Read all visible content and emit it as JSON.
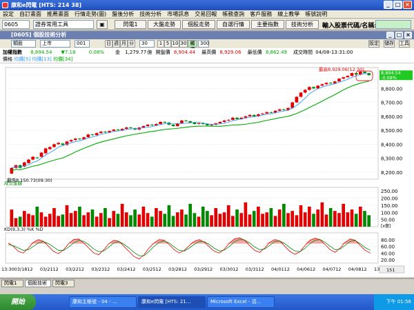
{
  "window": {
    "title": "康和e閃電 [HTS: 214 38]",
    "subwindow_title": "[0605] 個股技術分析"
  },
  "menu": [
    "設定",
    "自訂畫面",
    "推薦畫面",
    "行情走勢(圖)",
    "盤後分析",
    "技術分析",
    "市場訊息",
    "交易回報",
    "帳務查詢",
    "客戶服務",
    "線上教學",
    "帳號說明"
  ],
  "toolbar": {
    "stock_code": "0605",
    "tool_select": "證券常用工具",
    "buttons": [
      "閃電1",
      "大盤走勢",
      "個股走勢",
      "自選行情",
      "主要指數",
      "技術分析"
    ],
    "search_label": "輸入股票代碼/名稱:"
  },
  "chartbar": {
    "symbol": "類股",
    "market": "上市",
    "index": "001",
    "periods": [
      "日",
      "週",
      "月",
      "分"
    ],
    "interval": "30",
    "minutes": [
      "1",
      "5",
      "10",
      "30"
    ],
    "active": "觸價",
    "count": "300",
    "right_buttons": [
      "設定",
      "儲存",
      "工具"
    ]
  },
  "quote": {
    "name": "加權指數",
    "price": "8,894.54",
    "change": "▼7.18",
    "pct": "0.08%",
    "volume_label": "金",
    "volume": "1,279.77",
    "vol_unit": "億",
    "open_label": "開盤價",
    "open": "8,904.44",
    "high_label": "最高價",
    "high": "8,929.06",
    "low_label": "最低價",
    "low": "8,862.49",
    "time_label": "成交時間",
    "time": "04/08-13:31:00"
  },
  "chart_data": {
    "type": "candlestick",
    "legend": [
      "價格",
      "均價[5]",
      "均價[13]",
      "均價[34]"
    ],
    "price_axis": [
      "8,900.00",
      "8,800.00",
      "8,700.00",
      "8,600.00",
      "8,500.00",
      "8,400.00",
      "8,300.00",
      "8,200.00"
    ],
    "price_ylim": [
      8150,
      8950
    ],
    "last_price_tag": "8,894.54",
    "last_pct_tag": "-0.08%",
    "high_annotation": "最高8,929.06(12:30)",
    "low_annotation": "最低8,150.73(09:30)",
    "volume_title": "成交金額",
    "volume_axis": [
      "250.00",
      "200.00",
      "150.00",
      "100.00",
      "50.00"
    ],
    "volume_unit": "[x億]",
    "kd_title": "KD(9,3,3) %K %D",
    "kd_axis": [
      "80.00",
      "60.00",
      "40.00",
      "20.00"
    ],
    "x_labels": [
      "13:30",
      "03/18",
      "12",
      "03/21",
      "12",
      "03/22",
      "12",
      "03/23",
      "12",
      "03/24",
      "12",
      "03/25",
      "12",
      "03/28",
      "12",
      "03/29",
      "12",
      "03/30",
      "12",
      "03/31",
      "12",
      "04/01",
      "12",
      "04/06",
      "12",
      "04/07",
      "12",
      "04/08",
      "12",
      "13:30"
    ],
    "scroll_label": "151",
    "ma5_color": "#3399ff",
    "ma13_color": "#00aa00",
    "up_color": "#e00000",
    "down_color": "#008800",
    "candles": [
      [
        8190,
        8230
      ],
      [
        8230,
        8250
      ],
      [
        8250,
        8230
      ],
      [
        8240,
        8270
      ],
      [
        8265,
        8290
      ],
      [
        8290,
        8310
      ],
      [
        8305,
        8300
      ],
      [
        8310,
        8340
      ],
      [
        8335,
        8370
      ],
      [
        8365,
        8380
      ],
      [
        8380,
        8400
      ],
      [
        8400,
        8410
      ],
      [
        8405,
        8395
      ],
      [
        8395,
        8420
      ],
      [
        8420,
        8430
      ],
      [
        8430,
        8440
      ],
      [
        8440,
        8435
      ],
      [
        8435,
        8450
      ],
      [
        8450,
        8470
      ],
      [
        8470,
        8465
      ],
      [
        8465,
        8480
      ],
      [
        8480,
        8490
      ],
      [
        8490,
        8485
      ],
      [
        8485,
        8495
      ],
      [
        8495,
        8505
      ],
      [
        8505,
        8500
      ],
      [
        8500,
        8510
      ],
      [
        8510,
        8520
      ],
      [
        8520,
        8515
      ],
      [
        8515,
        8505
      ],
      [
        8505,
        8520
      ],
      [
        8520,
        8530
      ],
      [
        8530,
        8540
      ],
      [
        8540,
        8535
      ],
      [
        8535,
        8545
      ],
      [
        8545,
        8560
      ],
      [
        8560,
        8555
      ],
      [
        8555,
        8540
      ],
      [
        8540,
        8530
      ],
      [
        8530,
        8550
      ],
      [
        8550,
        8570
      ],
      [
        8570,
        8565
      ],
      [
        8565,
        8555
      ],
      [
        8555,
        8545
      ],
      [
        8545,
        8550
      ],
      [
        8550,
        8545
      ],
      [
        8545,
        8535
      ],
      [
        8535,
        8540
      ],
      [
        8540,
        8550
      ],
      [
        8550,
        8560
      ],
      [
        8560,
        8570
      ],
      [
        8570,
        8575
      ],
      [
        8575,
        8590
      ],
      [
        8590,
        8580
      ],
      [
        8580,
        8590
      ],
      [
        8590,
        8600
      ],
      [
        8600,
        8610
      ],
      [
        8610,
        8600
      ],
      [
        8600,
        8615
      ],
      [
        8615,
        8620
      ],
      [
        8620,
        8630
      ],
      [
        8630,
        8625
      ],
      [
        8625,
        8640
      ],
      [
        8640,
        8650
      ],
      [
        8650,
        8645
      ],
      [
        8645,
        8660
      ],
      [
        8660,
        8700
      ],
      [
        8700,
        8740
      ],
      [
        8740,
        8770
      ],
      [
        8770,
        8790
      ],
      [
        8790,
        8810
      ],
      [
        8810,
        8800
      ],
      [
        8800,
        8820
      ],
      [
        8820,
        8830
      ],
      [
        8830,
        8840
      ],
      [
        8840,
        8835
      ],
      [
        8835,
        8850
      ],
      [
        8850,
        8870
      ],
      [
        8870,
        8880
      ],
      [
        8880,
        8890
      ],
      [
        8890,
        8910
      ],
      [
        8910,
        8900
      ],
      [
        8900,
        8920
      ],
      [
        8920,
        8910
      ],
      [
        8910,
        8895
      ]
    ],
    "volumes": [
      120,
      60,
      70,
      110,
      90,
      80,
      140,
      100,
      70,
      90,
      130,
      75,
      85,
      150,
      95,
      110,
      140,
      80,
      100,
      120,
      70,
      95,
      130,
      60,
      110,
      90,
      160,
      100,
      80,
      120,
      85,
      140,
      95,
      70,
      130,
      110,
      90,
      150,
      75,
      100,
      120,
      85,
      160,
      95,
      70,
      140,
      110,
      80,
      130,
      90,
      100,
      150,
      75,
      120,
      95,
      170,
      85,
      110,
      140,
      90,
      100,
      130,
      75,
      120,
      160,
      95,
      110,
      80,
      150,
      100,
      140,
      90,
      120,
      170,
      85,
      130,
      110,
      95,
      160,
      100,
      120,
      90,
      140,
      110,
      80
    ],
    "kd_k": [
      70,
      60,
      45,
      40,
      55,
      72,
      80,
      75,
      60,
      45,
      38,
      50,
      68,
      80,
      82,
      70,
      55,
      40,
      35,
      50,
      68,
      78,
      75,
      60,
      45,
      30,
      22,
      35,
      55,
      70,
      80,
      78,
      65,
      50,
      40,
      48,
      62,
      75,
      80,
      72,
      58,
      45,
      40,
      52,
      70,
      82,
      85,
      78,
      62,
      48,
      42,
      55,
      72,
      80,
      76,
      60,
      45,
      36,
      44,
      62,
      78,
      84,
      80,
      65,
      50,
      42,
      55,
      72,
      82,
      78,
      62,
      48,
      40
    ],
    "kd_d": [
      65,
      62,
      55,
      48,
      50,
      60,
      70,
      74,
      68,
      58,
      48,
      48,
      58,
      70,
      78,
      75,
      65,
      52,
      44,
      46,
      58,
      70,
      74,
      66,
      55,
      42,
      32,
      32,
      45,
      60,
      72,
      76,
      70,
      58,
      48,
      46,
      55,
      66,
      75,
      74,
      65,
      54,
      46,
      49,
      60,
      74,
      80,
      79,
      70,
      58,
      50,
      52,
      63,
      74,
      76,
      68,
      56,
      46,
      44,
      54,
      68,
      78,
      80,
      72,
      60,
      50,
      52,
      63,
      75,
      77,
      68,
      56,
      48
    ]
  },
  "bottom_tabs": [
    "閃電1",
    "個股技術",
    "閃電3"
  ],
  "taskbar": {
    "start": "開始",
    "tasks": [
      "康和主帳號 - 04 - ...",
      "康和e閃電 [HTS: 21...",
      "Microsoft Excel - 活..."
    ],
    "clock": "下午 01:56"
  }
}
